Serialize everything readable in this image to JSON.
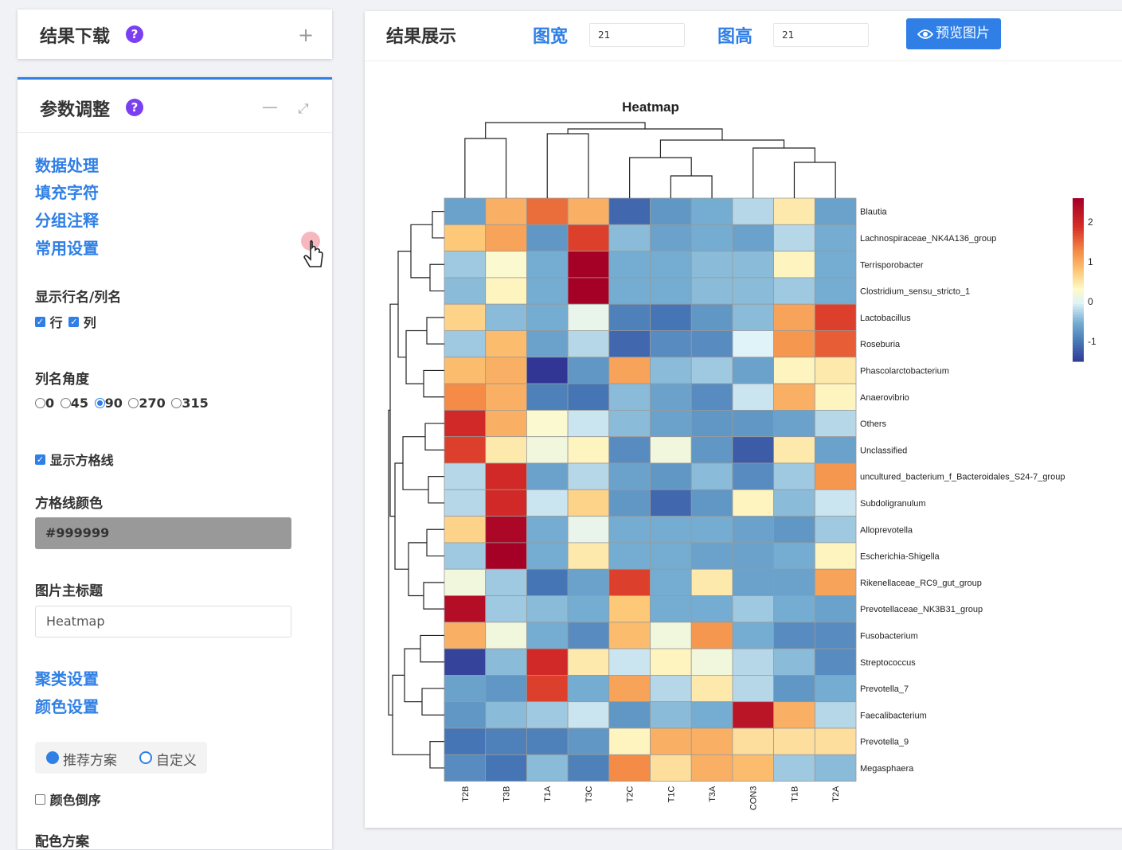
{
  "download_panel": {
    "title": "结果下载",
    "help": "?",
    "expand": "+"
  },
  "param_panel": {
    "title": "参数调整",
    "help": "?",
    "minimize": "—",
    "maximize": "⤢",
    "nav": [
      "数据处理",
      "填充字符",
      "分组注释",
      "常用设置"
    ],
    "show_names": {
      "label": "显示行名/列名",
      "row": "行",
      "col": "列"
    },
    "col_angle": {
      "label": "列名角度",
      "options": [
        "0",
        "45",
        "90",
        "270",
        "315"
      ],
      "selected": "90"
    },
    "grid": {
      "label": "显示方格线",
      "color_label": "方格线颜色",
      "color_value": "#999999"
    },
    "main_title": {
      "label": "图片主标题",
      "value": "Heatmap"
    },
    "cluster_link": "聚类设置",
    "color_link": "颜色设置",
    "scheme": {
      "recommended": "推荐方案",
      "custom": "自定义"
    },
    "reverse": "颜色倒序",
    "palette_label": "配色方案"
  },
  "main": {
    "title": "结果展示",
    "width_label": "图宽",
    "width_value": "21",
    "height_label": "图高",
    "height_value": "21",
    "preview_button": "预览图片",
    "preview_icon": "eye-icon"
  },
  "chart_data": {
    "type": "heatmap",
    "title": "Heatmap",
    "columns": [
      "T2B",
      "T3B",
      "T1A",
      "T3C",
      "T2C",
      "T1C",
      "T3A",
      "CON3",
      "T1B",
      "T2A"
    ],
    "rows": [
      "Blautia",
      "Lachnospiraceae_NK4A136_group",
      "Terrisporobacter",
      "Clostridium_sensu_stricto_1",
      "Lactobacillus",
      "Roseburia",
      "Phascolarctobacterium",
      "Anaerovibrio",
      "Others",
      "Unclassified",
      "uncultured_bacterium_f_Bacteroidales_S24-7_group",
      "Subdoligranulum",
      "Alloprevotella",
      "Escherichia-Shigella",
      "Rikenellaceae_RC9_gut_group",
      "Prevotellaceae_NK3B31_group",
      "Fusobacterium",
      "Streptococcus",
      "Prevotella_7",
      "Faecalibacterium",
      "Prevotella_9",
      "Megasphaera"
    ],
    "values": [
      [
        -0.6,
        1.0,
        1.5,
        1.0,
        -1.1,
        -0.7,
        -0.5,
        -0.2,
        0.5,
        -0.6
      ],
      [
        0.8,
        1.1,
        -0.7,
        1.8,
        -0.4,
        -0.6,
        -0.5,
        -0.6,
        -0.2,
        -0.5
      ],
      [
        -0.3,
        0.3,
        -0.5,
        2.6,
        -0.5,
        -0.5,
        -0.4,
        -0.4,
        0.4,
        -0.5
      ],
      [
        -0.4,
        0.4,
        -0.5,
        2.6,
        -0.5,
        -0.5,
        -0.4,
        -0.4,
        -0.3,
        -0.5
      ],
      [
        0.7,
        -0.4,
        -0.5,
        0.1,
        -0.9,
        -1.0,
        -0.7,
        -0.4,
        1.1,
        1.8
      ],
      [
        -0.3,
        0.9,
        -0.6,
        -0.2,
        -1.1,
        -0.8,
        -0.8,
        0.0,
        1.2,
        1.6
      ],
      [
        0.9,
        1.0,
        -2.0,
        -0.7,
        1.1,
        -0.4,
        -0.3,
        -0.6,
        0.4,
        0.5
      ],
      [
        1.3,
        1.0,
        -0.9,
        -1.0,
        -0.4,
        -0.6,
        -0.8,
        -0.1,
        1.0,
        0.4
      ],
      [
        2.0,
        1.0,
        0.3,
        -0.1,
        -0.4,
        -0.6,
        -0.7,
        -0.7,
        -0.6,
        -0.2
      ],
      [
        1.8,
        0.5,
        0.2,
        0.4,
        -0.8,
        0.2,
        -0.7,
        -1.2,
        0.5,
        -0.6
      ],
      [
        -0.2,
        2.0,
        -0.6,
        -0.2,
        -0.6,
        -0.7,
        -0.4,
        -0.8,
        -0.3,
        1.2
      ],
      [
        -0.2,
        2.0,
        -0.1,
        0.7,
        -0.7,
        -1.1,
        -0.7,
        0.4,
        -0.4,
        -0.1
      ],
      [
        0.7,
        2.5,
        -0.5,
        0.1,
        -0.5,
        -0.5,
        -0.5,
        -0.6,
        -0.7,
        -0.3
      ],
      [
        -0.3,
        2.6,
        -0.5,
        0.5,
        -0.5,
        -0.5,
        -0.6,
        -0.6,
        -0.5,
        0.4
      ],
      [
        0.2,
        -0.3,
        -1.0,
        -0.6,
        1.8,
        -0.5,
        0.5,
        -0.6,
        -0.6,
        1.1
      ],
      [
        2.4,
        -0.3,
        -0.4,
        -0.5,
        0.8,
        -0.5,
        -0.5,
        -0.3,
        -0.5,
        -0.6
      ],
      [
        1.0,
        0.2,
        -0.5,
        -0.8,
        0.9,
        0.2,
        1.2,
        -0.5,
        -0.8,
        -0.8
      ],
      [
        -1.4,
        -0.4,
        2.0,
        0.5,
        -0.1,
        0.4,
        0.2,
        -0.2,
        -0.4,
        -0.8
      ],
      [
        -0.6,
        -0.7,
        1.8,
        -0.5,
        1.1,
        -0.2,
        0.5,
        -0.2,
        -0.7,
        -0.5
      ],
      [
        -0.7,
        -0.4,
        -0.3,
        -0.1,
        -0.7,
        -0.4,
        -0.5,
        2.3,
        1.0,
        -0.2
      ],
      [
        -1.0,
        -0.9,
        -0.9,
        -0.7,
        0.4,
        1.0,
        1.0,
        0.6,
        0.6,
        0.6
      ],
      [
        -0.8,
        -1.0,
        -0.4,
        -0.9,
        1.3,
        0.6,
        1.0,
        0.9,
        -0.3,
        -0.4
      ]
    ],
    "legend_ticks": [
      2,
      1,
      0,
      -1
    ],
    "legend_range": [
      -1.5,
      2.6
    ]
  }
}
